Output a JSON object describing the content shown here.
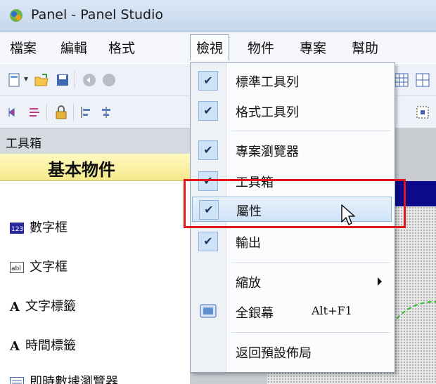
{
  "window": {
    "title": "Panel - Panel Studio",
    "icon": "app-logo-icon"
  },
  "menubar": {
    "items": [
      {
        "label": "檔案"
      },
      {
        "label": "編輯"
      },
      {
        "label": "格式"
      },
      {
        "label": "檢視",
        "active": true
      },
      {
        "label": "物件"
      },
      {
        "label": "專案"
      },
      {
        "label": "幫助"
      }
    ]
  },
  "toolbox": {
    "header": "工具箱",
    "section": "基本物件",
    "items": [
      {
        "label": "數字框",
        "icon": "numeric-box-icon"
      },
      {
        "label": "文字框",
        "icon": "text-box-icon"
      },
      {
        "label": "文字標籤",
        "icon": "text-label-icon"
      },
      {
        "label": "時間標籤",
        "icon": "time-label-icon"
      },
      {
        "label": "即時數據瀏覽器",
        "icon": "realtime-browser-icon"
      }
    ]
  },
  "view_menu": {
    "items": [
      {
        "label": "標準工具列",
        "checked": true
      },
      {
        "label": "格式工具列",
        "checked": true
      },
      {
        "label": "專案瀏覽器",
        "checked": true
      },
      {
        "label": "工具箱",
        "checked": true
      },
      {
        "label": "屬性",
        "checked": true,
        "highlighted": true
      },
      {
        "label": "輸出",
        "checked": true
      },
      {
        "label": "縮放",
        "submenu": true
      },
      {
        "label": "全銀幕",
        "shortcut": "Alt+F1",
        "icon": "fullscreen-icon"
      },
      {
        "label": "返回預設佈局"
      }
    ]
  },
  "colors": {
    "highlight": "#cfe3f7",
    "annotation": "#e0161b",
    "canvas_header": "#0a0a8a"
  }
}
